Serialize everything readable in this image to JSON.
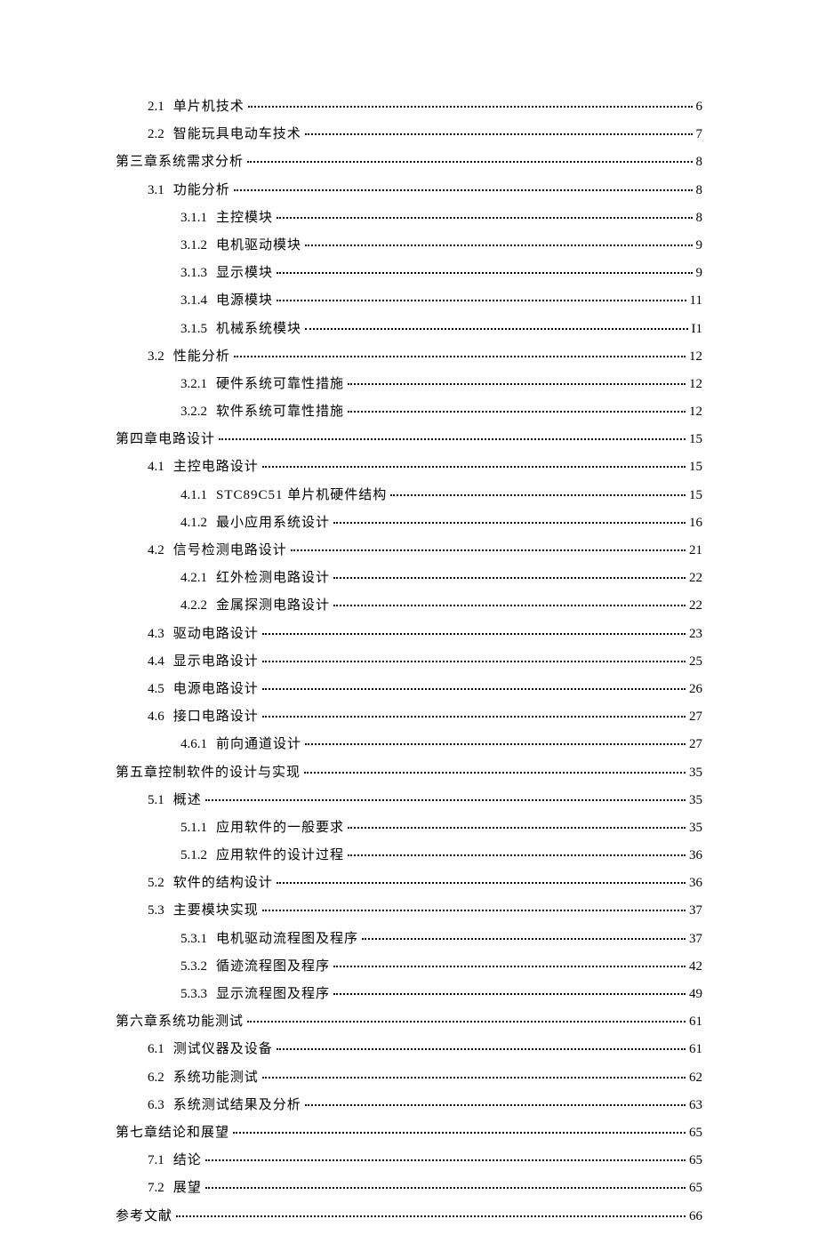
{
  "toc": [
    {
      "level": 1,
      "num": "2.1",
      "label": "单片机技术",
      "page": "6"
    },
    {
      "level": 1,
      "num": "2.2",
      "label": "智能玩具电动车技术",
      "page": "7"
    },
    {
      "level": 0,
      "num": "",
      "label": "第三章系统需求分析",
      "page": "8"
    },
    {
      "level": 1,
      "num": "3.1",
      "label": "功能分析",
      "page": "8"
    },
    {
      "level": 2,
      "num": "3.1.1",
      "label": "主控模块",
      "page": "8"
    },
    {
      "level": 2,
      "num": "3.1.2",
      "label": "电机驱动模块",
      "page": "9"
    },
    {
      "level": 2,
      "num": "3.1.3",
      "label": "显示模块",
      "page": "9"
    },
    {
      "level": 2,
      "num": "3.1.4",
      "label": "电源模块",
      "page": "11"
    },
    {
      "level": 2,
      "num": "3.1.5",
      "label": "机械系统模块",
      "page": "I1"
    },
    {
      "level": 1,
      "num": "3.2",
      "label": "性能分析",
      "page": "12"
    },
    {
      "level": 2,
      "num": "3.2.1",
      "label": "硬件系统可靠性措施",
      "page": "12"
    },
    {
      "level": 2,
      "num": "3.2.2",
      "label": "软件系统可靠性措施",
      "page": "12"
    },
    {
      "level": 0,
      "num": "",
      "label": "第四章电路设计",
      "page": "15"
    },
    {
      "level": 1,
      "num": "4.1",
      "label": "主控电路设计",
      "page": "15"
    },
    {
      "level": 2,
      "num": "4.1.1",
      "label": "STC89C51 单片机硬件结构",
      "page": "15"
    },
    {
      "level": 2,
      "num": "4.1.2",
      "label": "最小应用系统设计",
      "page": "16"
    },
    {
      "level": 1,
      "num": "4.2",
      "label": "信号检测电路设计",
      "page": "21"
    },
    {
      "level": 2,
      "num": "4.2.1",
      "label": "红外检测电路设计",
      "page": "22"
    },
    {
      "level": 2,
      "num": "4.2.2",
      "label": "金属探测电路设计",
      "page": "22"
    },
    {
      "level": 1,
      "num": "4.3",
      "label": "驱动电路设计",
      "page": "23"
    },
    {
      "level": 1,
      "num": "4.4",
      "label": "显示电路设计",
      "page": "25"
    },
    {
      "level": 1,
      "num": "4.5",
      "label": "电源电路设计",
      "page": "26"
    },
    {
      "level": 1,
      "num": "4.6",
      "label": "接口电路设计",
      "page": "27"
    },
    {
      "level": 2,
      "num": "4.6.1",
      "label": "前向通道设计",
      "page": "27"
    },
    {
      "level": 0,
      "num": "",
      "label": "第五章控制软件的设计与实现",
      "page": "35"
    },
    {
      "level": 1,
      "num": "5.1",
      "label": "概述",
      "page": "35"
    },
    {
      "level": 2,
      "num": "5.1.1",
      "label": "应用软件的一般要求",
      "page": "35"
    },
    {
      "level": 2,
      "num": "5.1.2",
      "label": "应用软件的设计过程",
      "page": "36"
    },
    {
      "level": 1,
      "num": "5.2",
      "label": "软件的结构设计",
      "page": "36"
    },
    {
      "level": 1,
      "num": "5.3",
      "label": "主要模块实现",
      "page": "37"
    },
    {
      "level": 2,
      "num": "5.3.1",
      "label": "电机驱动流程图及程序",
      "page": "37"
    },
    {
      "level": 2,
      "num": "5.3.2",
      "label": "循迹流程图及程序",
      "page": "42"
    },
    {
      "level": 2,
      "num": "5.3.3",
      "label": "显示流程图及程序",
      "page": "49"
    },
    {
      "level": 0,
      "num": "",
      "label": "第六章系统功能测试",
      "page": "61"
    },
    {
      "level": 1,
      "num": "6.1",
      "label": "测试仪器及设备",
      "page": "61"
    },
    {
      "level": 1,
      "num": "6.2",
      "label": "系统功能测试",
      "page": "62"
    },
    {
      "level": 1,
      "num": "6.3",
      "label": "系统测试结果及分析",
      "page": "63"
    },
    {
      "level": 0,
      "num": "",
      "label": "第七章结论和展望",
      "page": "65"
    },
    {
      "level": 1,
      "num": "7.1",
      "label": "结论",
      "page": "65"
    },
    {
      "level": 1,
      "num": "7.2",
      "label": "展望",
      "page": "65"
    },
    {
      "level": 0,
      "num": "",
      "label": "参考文献",
      "page": "66"
    }
  ]
}
